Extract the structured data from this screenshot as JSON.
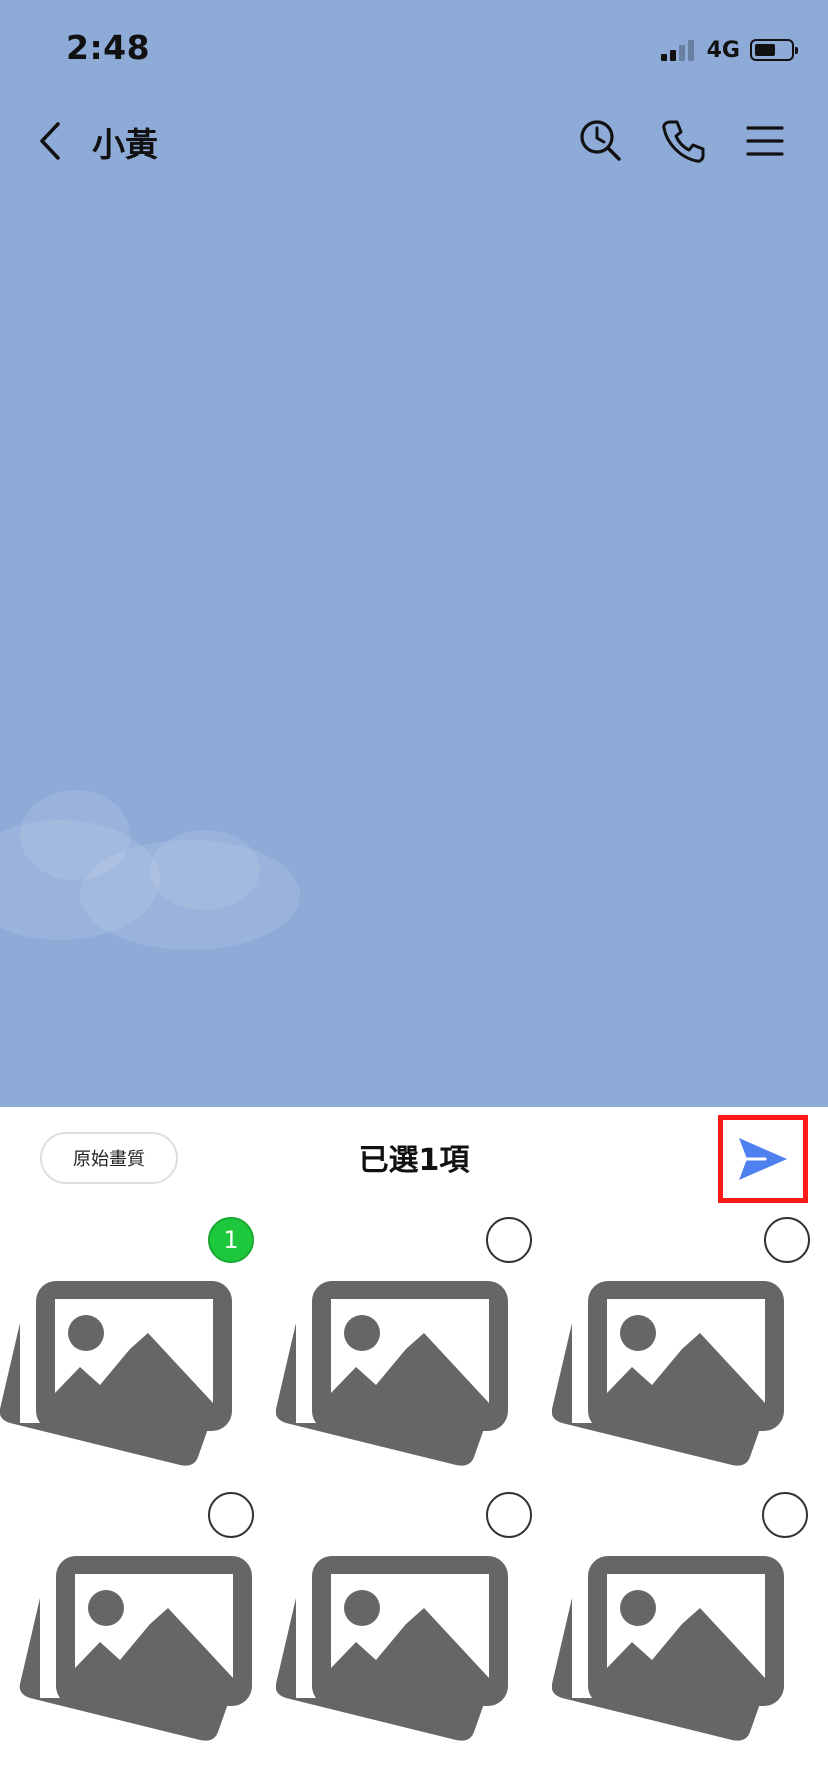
{
  "status_bar": {
    "time": "2:48",
    "network": "4G",
    "signal_bars": 4,
    "signal_bars_active": 2,
    "battery_level_percent": 60
  },
  "nav": {
    "back_icon": "chevron-left-icon",
    "title": "小黃",
    "search_icon": "search-history-icon",
    "call_icon": "phone-icon",
    "menu_icon": "hamburger-menu-icon"
  },
  "photo_picker": {
    "quality_label": "原始畫質",
    "selected_label": "已選1項",
    "send_icon": "send-arrow-icon",
    "photos": [
      {
        "selected": true,
        "order": "1"
      },
      {
        "selected": false,
        "order": ""
      },
      {
        "selected": false,
        "order": ""
      },
      {
        "selected": false,
        "order": ""
      },
      {
        "selected": false,
        "order": ""
      },
      {
        "selected": false,
        "order": ""
      }
    ],
    "photo_icon": "photo-stack-icon"
  },
  "colors": {
    "chat_background": "#8eabd8",
    "send_icon": "#4f80f0",
    "selected_badge": "#1ec83c",
    "highlight_box": "#ff1a1a",
    "placeholder_icon": "#666666"
  }
}
